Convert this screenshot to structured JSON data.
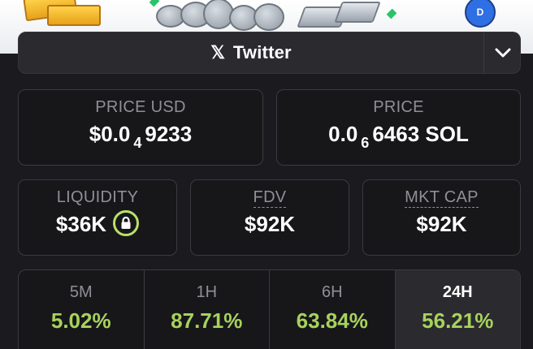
{
  "social": {
    "icon": "x-logo-icon",
    "label": "Twitter"
  },
  "price_usd": {
    "label": "PRICE USD",
    "prefix": "$0.0",
    "zeros": "4",
    "digits": "9233"
  },
  "price_native": {
    "label": "PRICE",
    "prefix": "0.0",
    "zeros": "6",
    "digits": "6463",
    "unit": "SOL"
  },
  "liquidity": {
    "label": "LIQUIDITY",
    "value": "$36K",
    "icon": "lock-icon"
  },
  "fdv": {
    "label": "FDV",
    "value": "$92K"
  },
  "mkt_cap": {
    "label": "MKT CAP",
    "value": "$92K"
  },
  "periods": [
    {
      "label": "5M",
      "value": "5.02%"
    },
    {
      "label": "1H",
      "value": "87.71%"
    },
    {
      "label": "6H",
      "value": "63.84%"
    },
    {
      "label": "24H",
      "value": "56.21%",
      "active": true
    }
  ],
  "colors": {
    "positive": "#a7d25c",
    "background": "#1b1b1f",
    "card": "#17171a",
    "accent_lock": "#b9e06a"
  }
}
